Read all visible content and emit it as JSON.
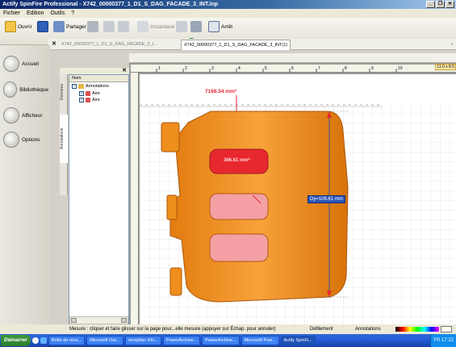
{
  "window": {
    "title": "Actify SpinFire Professional - X742_00000377_1_D1_S_DAG_FACADE_3_INT.inp",
    "controls": [
      "_",
      "❐",
      "✕"
    ]
  },
  "menu": {
    "items": [
      "Fichier",
      "Edition",
      "Outils",
      "?"
    ]
  },
  "toolbar": {
    "ouvrir": "Ouvrir",
    "partager": "Partager",
    "instantane": "Instantané",
    "arret": "Arrêt"
  },
  "docbar": {
    "close": "✕",
    "tab_left": "X742_00000377_1_D1_S_DAG_FACADE_3_I...",
    "tab_right": "X742_00000377_1_D1_S_DAG_FACADE_3_INT(1)",
    "scroll_right": "›"
  },
  "nav": {
    "accueil": "Accueil",
    "bibliotheque": "Bibliothèque",
    "afficheur": "Afficheur",
    "options": "Options"
  },
  "panel": {
    "close": "✕",
    "tab_donnees": "Données",
    "tab_annotations": "Annotations",
    "column_header": "Nom",
    "tree": [
      {
        "label": "Annotations",
        "checked": "✓"
      },
      {
        "label": "Aire",
        "checked": "✓"
      },
      {
        "label": "Aire",
        "checked": "✓"
      }
    ]
  },
  "viewer": {
    "ruler_top_ticks": [
      "1",
      "2",
      "3",
      "4",
      "5",
      "6",
      "7",
      "8",
      "9",
      "10"
    ],
    "zoom": "11.0 x 8.5",
    "area_label_top": "7168.54 mm²",
    "area_label_inner": "366.61 mm²",
    "dim_label": "Dy=106.61 mm",
    "accent": "#e8282f",
    "part_color": "#f2941c"
  },
  "status": {
    "message": "Mesure : cliquer et faire glisser sur la page pour...elle mesure (appuyer sur Échap. pour annuler)",
    "deplacement": "Défilement",
    "annotations": "Annotations"
  },
  "taskbar": {
    "start": "Démarrer",
    "tasks": [
      "Boîte de réce...",
      "Microsoft Out...",
      "réception d'in...",
      "PowerArchive...",
      "PowerArchive...",
      "Microsoft Pow...",
      "Actify SpinFi..."
    ],
    "lang": "FR",
    "time": "17:22"
  }
}
